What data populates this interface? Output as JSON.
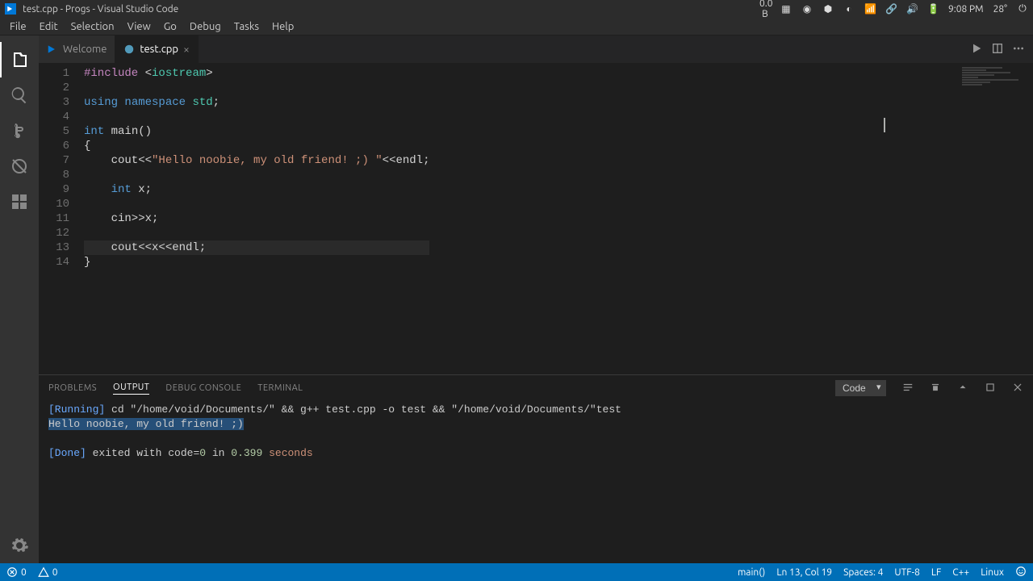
{
  "system": {
    "net": "0.0 B",
    "time": "9:08 PM",
    "temp": "28°"
  },
  "window": {
    "title": "test.cpp - Progs - Visual Studio Code"
  },
  "menu": {
    "file": "File",
    "edit": "Edit",
    "selection": "Selection",
    "view": "View",
    "go": "Go",
    "debug": "Debug",
    "tasks": "Tasks",
    "help": "Help"
  },
  "tabs": {
    "welcome": "Welcome",
    "test": "test.cpp"
  },
  "editor": {
    "filename": "test.cpp",
    "lines": [
      {
        "n": 1,
        "t": [
          [
            "pre",
            "#include "
          ],
          [
            "pun",
            "<"
          ],
          [
            "kw2",
            "iostream"
          ],
          [
            "pun",
            ">"
          ]
        ]
      },
      {
        "n": 2,
        "t": []
      },
      {
        "n": 3,
        "t": [
          [
            "kw",
            "using"
          ],
          [
            "pun",
            " "
          ],
          [
            "kw",
            "namespace"
          ],
          [
            "pun",
            " "
          ],
          [
            "kw2",
            "std"
          ],
          [
            "pun",
            ";"
          ]
        ]
      },
      {
        "n": 4,
        "t": []
      },
      {
        "n": 5,
        "t": [
          [
            "kw",
            "int"
          ],
          [
            "pun",
            " "
          ],
          [
            "pun",
            "main()"
          ]
        ]
      },
      {
        "n": 6,
        "t": [
          [
            "pun",
            "{"
          ]
        ]
      },
      {
        "n": 7,
        "t": [
          [
            "pun",
            "    cout<<"
          ],
          [
            "str",
            "\"Hello noobie, my old friend! ;) \""
          ],
          [
            "pun",
            "<<endl;"
          ]
        ]
      },
      {
        "n": 8,
        "t": []
      },
      {
        "n": 9,
        "t": [
          [
            "pun",
            "    "
          ],
          [
            "kw",
            "int"
          ],
          [
            "pun",
            " x;"
          ]
        ]
      },
      {
        "n": 10,
        "t": []
      },
      {
        "n": 11,
        "t": [
          [
            "pun",
            "    cin>>x;"
          ]
        ]
      },
      {
        "n": 12,
        "t": []
      },
      {
        "n": 13,
        "t": [
          [
            "pun",
            "    cout<<x<<endl;"
          ]
        ]
      },
      {
        "n": 14,
        "t": [
          [
            "pun",
            "}"
          ]
        ]
      }
    ],
    "current_line": 13
  },
  "panel": {
    "tabs": {
      "problems": "PROBLEMS",
      "output": "OUTPUT",
      "debug": "DEBUG CONSOLE",
      "terminal": "TERMINAL"
    },
    "active": "output",
    "selector": "Code",
    "output": {
      "run_tag": "[Running]",
      "run_cmd": " cd \"/home/void/Documents/\" && g++ test.cpp -o test && \"/home/void/Documents/\"test",
      "echo": "Hello noobie, my old friend! ;)",
      "done_tag": "[Done]",
      "done_pre": " exited with ",
      "done_code_label": "code=",
      "done_code": "0",
      "done_in": " in ",
      "done_time": "0.399",
      "done_sec": " seconds"
    }
  },
  "status": {
    "errors": "0",
    "warnings": "0",
    "func": "main()",
    "pos": "Ln 13, Col 19",
    "spaces": "Spaces: 4",
    "encoding": "UTF-8",
    "eol": "LF",
    "lang": "C++",
    "os": "Linux"
  }
}
